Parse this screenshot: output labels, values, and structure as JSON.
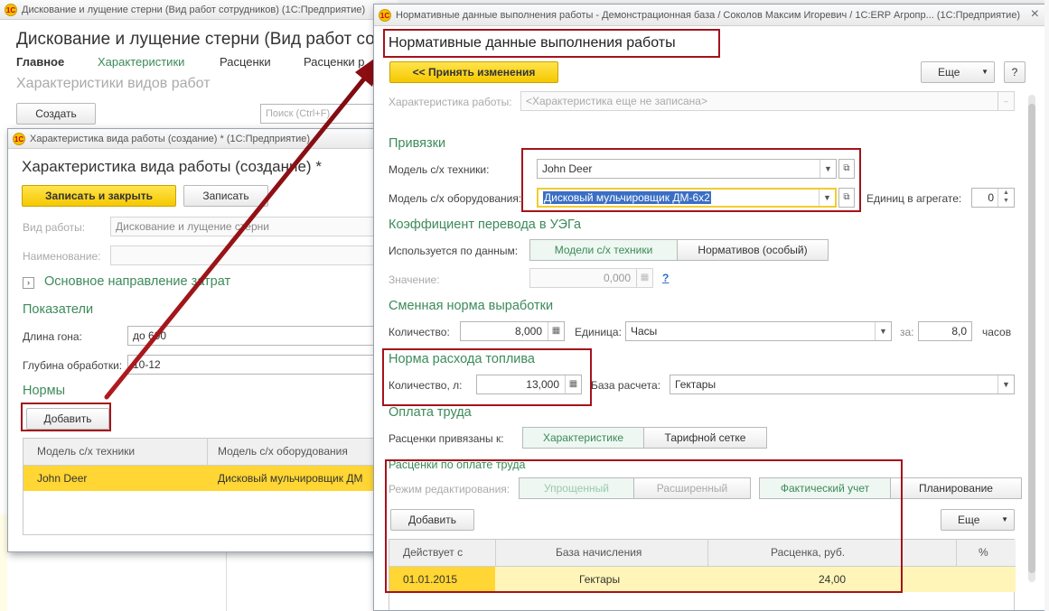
{
  "main_window": {
    "title": "Дискование и лущение стерни (Вид работ сотрудников)  (1С:Предприятие)",
    "heading": "Дискование и лущение стерни (Вид работ сотр",
    "nav": [
      "Главное",
      "Характеристики",
      "Расценки",
      "Расценки р"
    ],
    "subheading": "Характеристики видов работ",
    "create_button": "Создать",
    "search_placeholder": "Поиск (Ctrl+F)"
  },
  "char_window": {
    "title": "Характеристика вида работы (создание) *  (1С:Предприятие)",
    "heading": "Характеристика вида работы (создание) *",
    "save_close": "Записать и закрыть",
    "save": "Записать",
    "work_type_label": "Вид работы:",
    "work_type_value": "Дискование и лущение стерни",
    "name_label": "Наименование:",
    "cost_direction": "Основное направление затрат",
    "indicators_title": "Показатели",
    "length_label": "Длина гона:",
    "length_value": "до 600",
    "depth_label": "Глубина обработки:",
    "depth_value": "10-12",
    "norms_title": "Нормы",
    "add_button": "Добавить",
    "table": {
      "headers": [
        "Модель с/х техники",
        "Модель с/х оборудования"
      ],
      "row": [
        "John Deer",
        "Дисковый мульчировщик ДМ"
      ]
    }
  },
  "norm_window": {
    "title": "Нормативные данные выполнения работы - Демонстрационная база / Соколов Максим Игоревич / 1С:ERP Агропр...  (1С:Предприятие)",
    "heading": "Нормативные данные выполнения работы",
    "accept_button": "<< Принять изменения",
    "more_button": "Еще",
    "help_button": "?",
    "char_label": "Характеристика работы:",
    "char_placeholder": "<Характеристика еще не записана>",
    "links_title": "Привязки",
    "tech_label": "Модель с/х техники:",
    "tech_value": "John Deer",
    "equip_label": "Модель с/х оборудования:",
    "equip_value": "Дисковый мульчировщик ДМ-6х2",
    "units_label": "Единиц в агрегате:",
    "units_value": "0",
    "coef_title": "Коэффициент перевода в УЭГа",
    "used_by_label": "Используется по данным:",
    "used_by_options": [
      "Модели с/х техники",
      "Нормативов (особый)"
    ],
    "value_label": "Значение:",
    "value_value": "0,000",
    "value_help": "?",
    "shift_title": "Сменная норма выработки",
    "qty_label": "Количество:",
    "qty_value": "8,000",
    "unit_label": "Единица:",
    "unit_value": "Часы",
    "per_label": "за:",
    "per_value": "8,0",
    "hours_label": "часов",
    "fuel_title": "Норма расхода топлива",
    "fuel_qty_label": "Количество, л:",
    "fuel_qty_value": "13,000",
    "base_label": "База расчета:",
    "base_value": "Гектары",
    "pay_title": "Оплата труда",
    "rates_bound_label": "Расценки привязаны к:",
    "rates_bound_options": [
      "Характеристике",
      "Тарифной сетке"
    ],
    "rates_title": "Расценки по оплате труда",
    "edit_mode_label": "Режим редактирования:",
    "edit_mode_options": [
      "Упрощенный",
      "Расширенный"
    ],
    "accounting_options": [
      "Фактический учет",
      "Планирование"
    ],
    "add_button": "Добавить",
    "more2_button": "Еще",
    "table": {
      "headers": [
        "Действует с",
        "База начисления",
        "Расценка, руб.",
        "%"
      ],
      "row": [
        "01.01.2015",
        "Гектары",
        "24,00",
        ""
      ]
    }
  },
  "accent_colors": {
    "section": "#3c8a5a",
    "highlight_box": "#a4131b",
    "yellow_button": "#f5c800"
  }
}
